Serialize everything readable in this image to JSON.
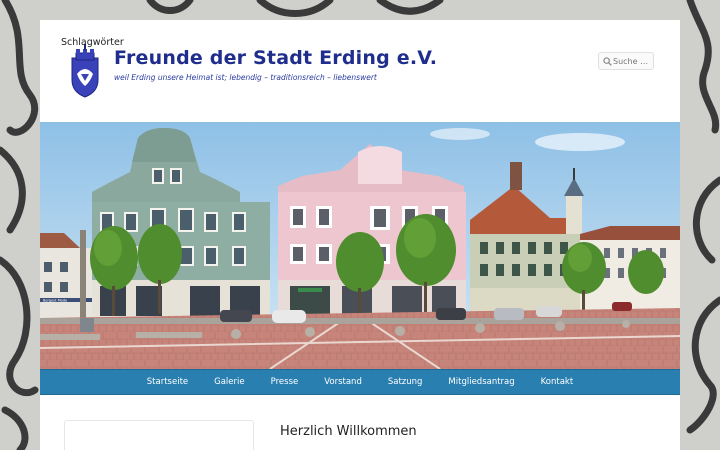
{
  "site": {
    "title": "Freunde der Stadt Erding e.V.",
    "description": "weil Erding unsere Heimat ist; lebendig – traditionsreich – liebenswert"
  },
  "search": {
    "placeholder": "Suche …"
  },
  "nav": {
    "items": [
      "Startseite",
      "Galerie",
      "Presse",
      "Vorstand",
      "Satzung",
      "Mitgliedsantrag",
      "Kontakt"
    ]
  },
  "sidebar": {
    "widget_title": "Schlagwörter"
  },
  "main": {
    "heading": "Herzlich Willkommen"
  },
  "hero": {
    "shop_sign": "Bergest Mode"
  },
  "colors": {
    "title": "#1f2d8c",
    "nav_background": "#2a7fb1",
    "nav_text": "#ffffff",
    "page_background": "#ffffff"
  }
}
